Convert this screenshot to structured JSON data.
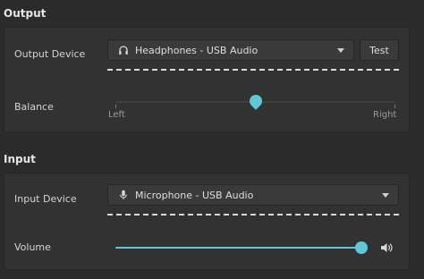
{
  "output": {
    "title": "Output",
    "device_label": "Output Device",
    "device_value": "Headphones - USB Audio",
    "device_icon": "headphones-icon",
    "test_label": "Test",
    "balance_label": "Balance",
    "balance_left": "Left",
    "balance_right": "Right",
    "balance_value": 0.5
  },
  "input": {
    "title": "Input",
    "device_label": "Input Device",
    "device_value": "Microphone - USB Audio",
    "device_icon": "microphone-icon",
    "volume_label": "Volume",
    "volume_value": 1.0,
    "volume_icon": "speaker-icon"
  },
  "colors": {
    "accent": "#62c6d6",
    "background": "#2b2b2b",
    "panel": "#323232"
  }
}
